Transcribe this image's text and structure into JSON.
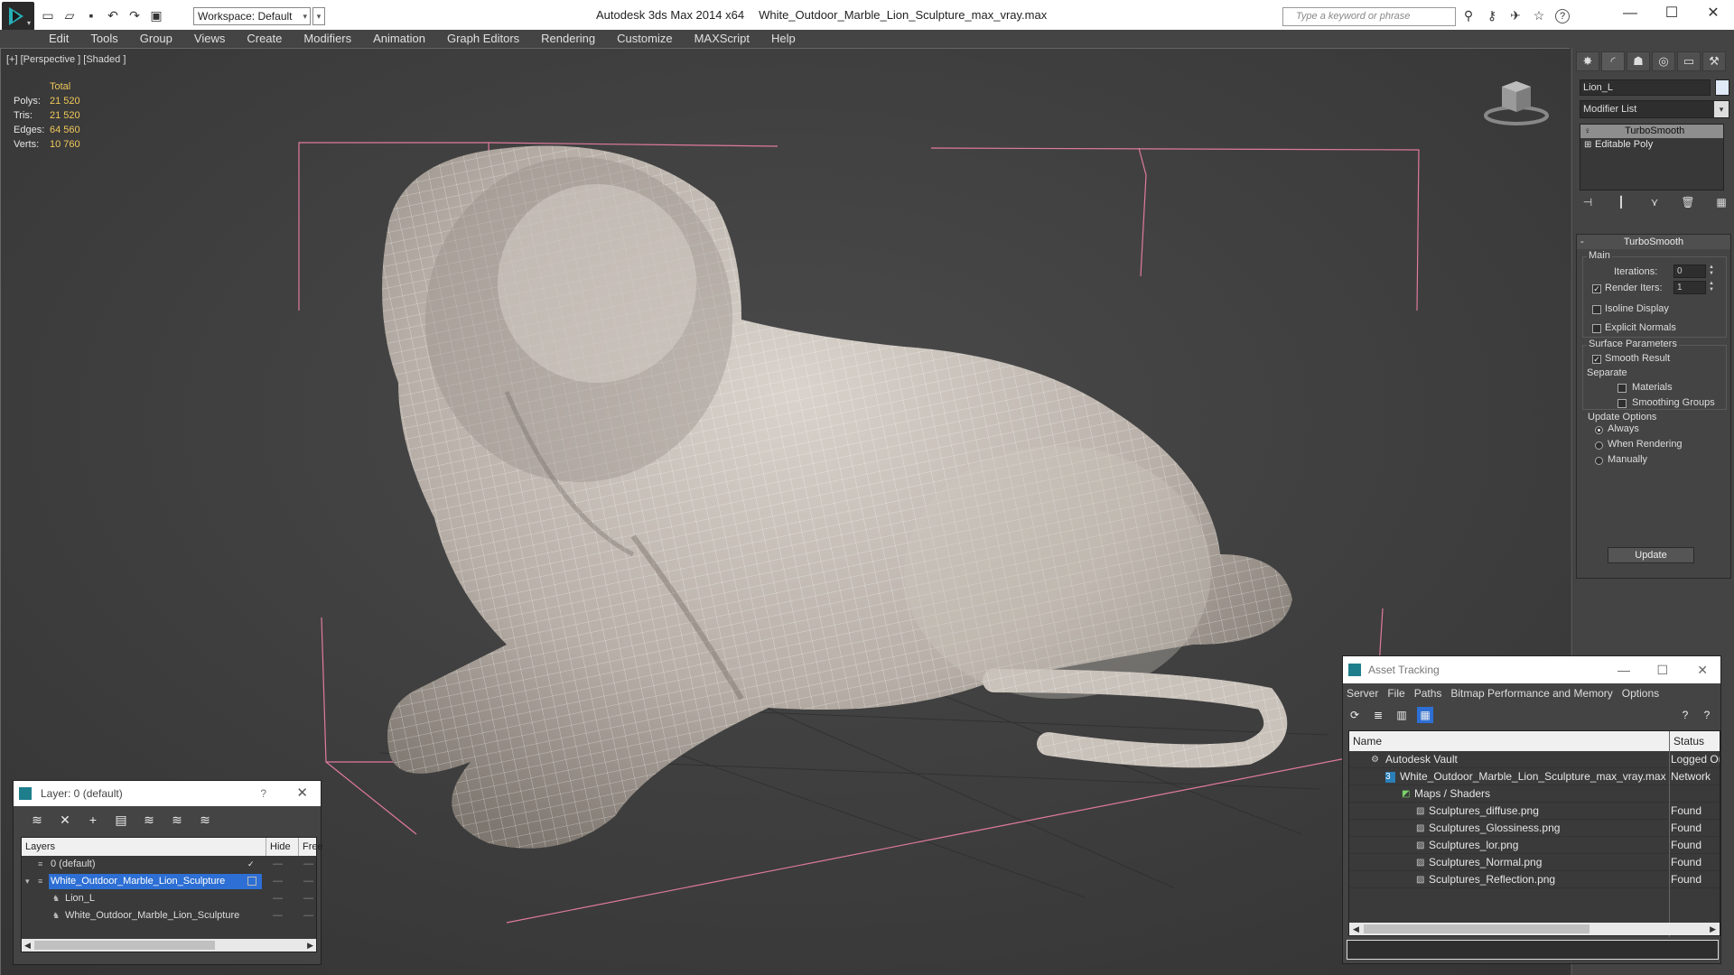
{
  "app": {
    "title": "Autodesk 3ds Max  2014 x64",
    "file": "White_Outdoor_Marble_Lion_Sculpture_max_vray.max",
    "workspace": "Workspace: Default",
    "search_placeholder": "Type a keyword or phrase"
  },
  "menu": [
    "Edit",
    "Tools",
    "Group",
    "Views",
    "Create",
    "Modifiers",
    "Animation",
    "Graph Editors",
    "Rendering",
    "Customize",
    "MAXScript",
    "Help"
  ],
  "viewport": {
    "label": "[+] [Perspective ] [Shaded ]",
    "stats": {
      "total_label": "Total",
      "rows": [
        {
          "k": "Polys:",
          "v": "21 520"
        },
        {
          "k": "Tris:",
          "v": "21 520"
        },
        {
          "k": "Edges:",
          "v": "64 560"
        },
        {
          "k": "Verts:",
          "v": "10 760"
        }
      ]
    }
  },
  "command_panel": {
    "object_name": "Lion_L",
    "modifier_list": "Modifier List",
    "stack": [
      "TurboSmooth",
      "Editable Poly"
    ],
    "rollout": "TurboSmooth",
    "main_label": "Main",
    "iterations_label": "Iterations:",
    "iterations_value": "0",
    "render_iters_label": "Render Iters:",
    "render_iters_value": "1",
    "isoline": "Isoline Display",
    "explicit_normals": "Explicit Normals",
    "surface_params": "Surface Parameters",
    "smooth_result": "Smooth Result",
    "separate": "Separate",
    "materials": "Materials",
    "smoothing_groups": "Smoothing Groups",
    "update_options": "Update Options",
    "always": "Always",
    "when_rendering": "When Rendering",
    "manually": "Manually",
    "update_button": "Update"
  },
  "layer_dialog": {
    "title": "Layer: 0 (default)",
    "col_layers": "Layers",
    "col_hide": "Hide",
    "col_freeze": "Free",
    "rows": [
      {
        "name": "0 (default)"
      },
      {
        "name": "White_Outdoor_Marble_Lion_Sculpture"
      },
      {
        "name": "Lion_L"
      },
      {
        "name": "White_Outdoor_Marble_Lion_Sculpture"
      }
    ]
  },
  "asset_dialog": {
    "title": "Asset Tracking",
    "menu": [
      "Server",
      "File",
      "Paths",
      "Bitmap Performance and Memory",
      "Options"
    ],
    "col_name": "Name",
    "col_status": "Status",
    "rows": [
      {
        "name": "Autodesk Vault",
        "status": "Logged Out"
      },
      {
        "name": "White_Outdoor_Marble_Lion_Sculpture_max_vray.max",
        "status": "Network"
      },
      {
        "name": "Maps / Shaders",
        "status": ""
      },
      {
        "name": "Sculptures_diffuse.png",
        "status": "Found"
      },
      {
        "name": "Sculptures_Glossiness.png",
        "status": "Found"
      },
      {
        "name": "Sculptures_lor.png",
        "status": "Found"
      },
      {
        "name": "Sculptures_Normal.png",
        "status": "Found"
      },
      {
        "name": "Sculptures_Reflection.png",
        "status": "Found"
      }
    ]
  }
}
